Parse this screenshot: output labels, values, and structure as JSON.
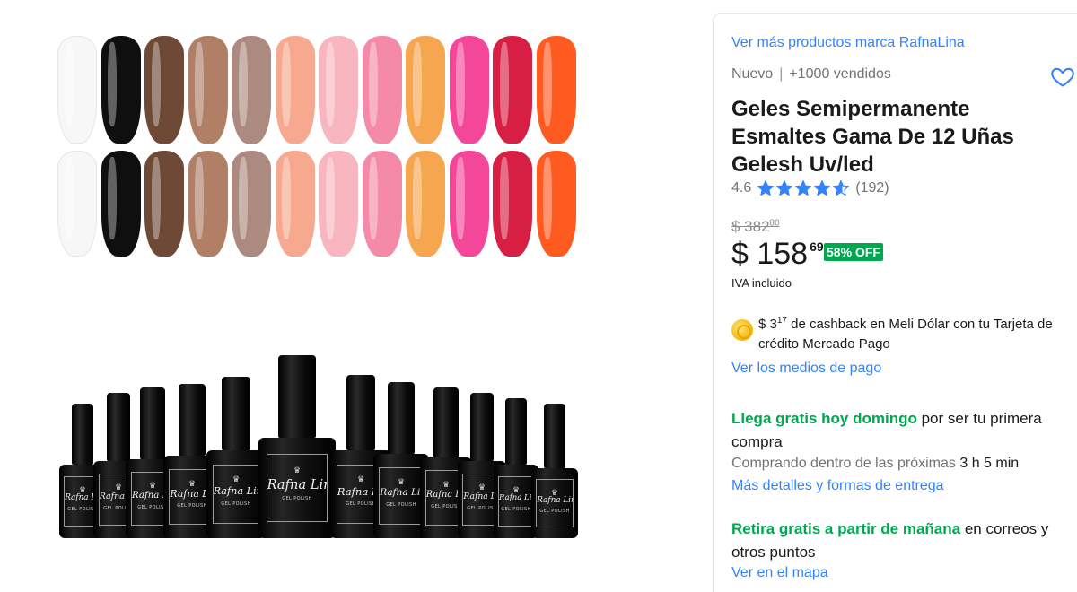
{
  "gallery": {
    "nail_colors": [
      "#f7f7f7",
      "#0f0f0f",
      "#6e4a36",
      "#b07f66",
      "#ad8a7f",
      "#f7a98f",
      "#f7b6c0",
      "#f48aa7",
      "#f6a64f",
      "#f5479a",
      "#d71f44",
      "#ff5a1f"
    ],
    "bottle_brand": "Rafna Lina",
    "bottle_sub": "GEL POLISH"
  },
  "product": {
    "brand_link": "Ver más productos marca RafnaLina",
    "condition": "Nuevo",
    "sold": "+1000 vendidos",
    "title": "Geles Semipermanente Esmaltes Gama De 12 Uñas Gelesh Uv/led",
    "rating": "4.6",
    "rating_stars": 4.6,
    "reviews": "(192)",
    "old_price_main": "$ 382",
    "old_price_cents": "80",
    "price_main": "$ 158",
    "price_cents": "69",
    "discount": "58% OFF",
    "iva": "IVA incluido",
    "cashback_amount": "$ 3",
    "cashback_cents": "17",
    "cashback_text": " de cashback en Meli Dólar con tu Tarjeta de crédito Mercado Pago",
    "payment_link": "Ver los medios de pago",
    "shipping_free": "Llega gratis hoy domingo",
    "shipping_rest": " por ser tu primera compra",
    "buying_prefix": "Comprando dentro de las próximas ",
    "buying_time": "3 h 5 min",
    "details_link": "Más detalles y formas de entrega",
    "pickup_free": "Retira gratis a partir de mañana",
    "pickup_rest": " en correos y otros puntos",
    "map_link": "Ver en el mapa"
  },
  "colors": {
    "link": "#3483fa",
    "green": "#00a650",
    "star": "#3483fa"
  },
  "icons": {
    "favorite": "heart-outline-icon",
    "star": "star-icon",
    "coin": "meli-dolar-coin-icon"
  }
}
